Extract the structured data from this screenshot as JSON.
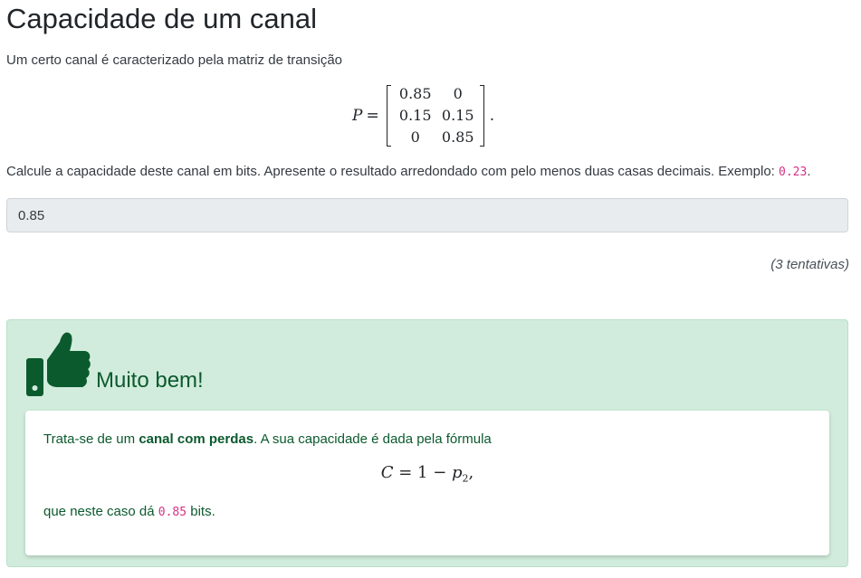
{
  "title": "Capacidade de um canal",
  "intro": "Um certo canal é caracterizado pela matriz de transição",
  "matrix": {
    "lhs": "P",
    "equals": "=",
    "rows": [
      [
        "0.85",
        "0"
      ],
      [
        "0.15",
        "0.15"
      ],
      [
        "0",
        "0.85"
      ]
    ],
    "trailing": "."
  },
  "question": {
    "text": "Calcule a capacidade deste canal em bits. Apresente o resultado arredondado com pelo menos duas casas decimais. Exemplo: ",
    "example_code": "0.23",
    "suffix": "."
  },
  "answer": {
    "value": "0.85"
  },
  "attempts": "(3 tentativas)",
  "feedback": {
    "icon": "thumbs-up-icon",
    "title": "Muito bem!",
    "line1_prefix": "Trata-se de um ",
    "line1_bold": "canal com perdas",
    "line1_suffix": ". A sua capacidade é dada pela fórmula",
    "formula_lhs": "C",
    "formula_mid": " = 1 − ",
    "formula_var": "p",
    "formula_sub": "2",
    "formula_end": ",",
    "line2_prefix": "que neste caso dá ",
    "line2_code": "0.85",
    "line2_suffix": " bits."
  },
  "colors": {
    "success_bg": "#d1ecdc",
    "success_text": "#0b5a2e",
    "code": "#d63384",
    "input_bg": "#e9ecef"
  }
}
